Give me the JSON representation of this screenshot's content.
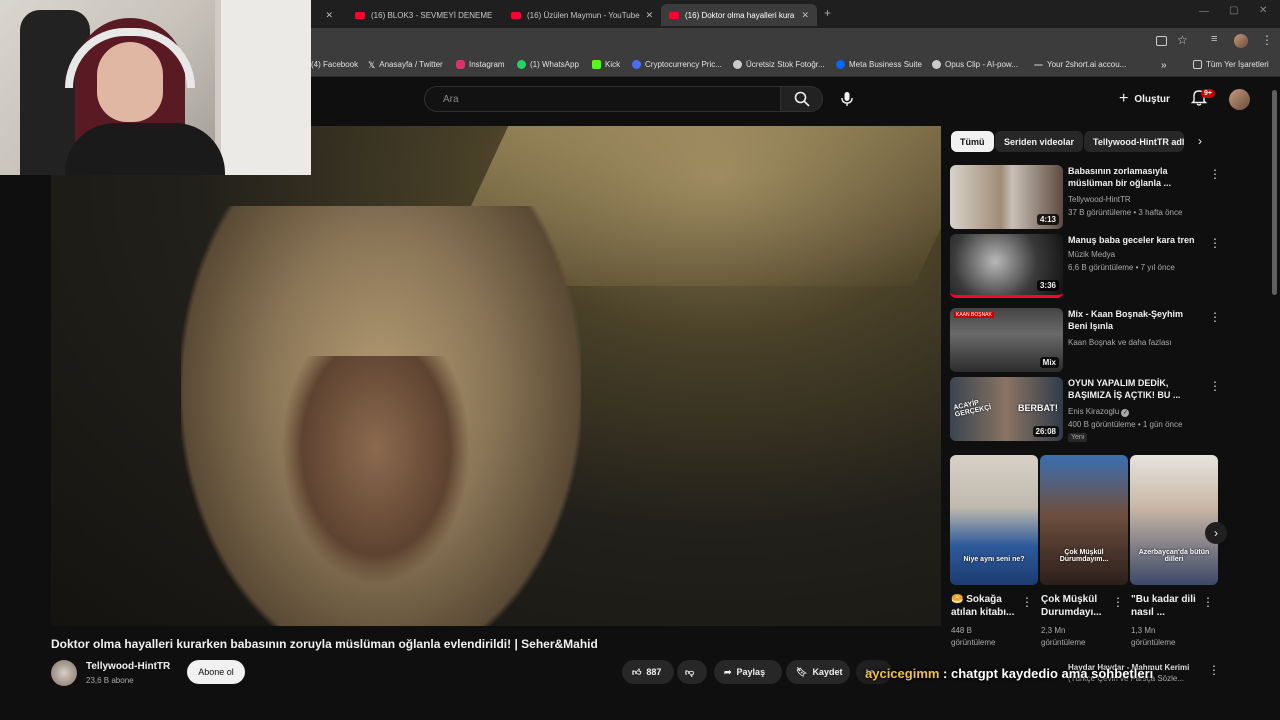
{
  "tabs": [
    {
      "label": "(16) BLOK3 - SEVMEYİ DENEME"
    },
    {
      "label": "(16) Üzülen Maymun - YouTube"
    },
    {
      "label": "(16) Doktor olma hayalleri kura"
    }
  ],
  "bookmarks": [
    {
      "label": "(4) Facebook",
      "color": "#1877f2"
    },
    {
      "label": "Anasayfa / Twitter",
      "color": "#ffffff"
    },
    {
      "label": "Instagram",
      "color": "#e1306c"
    },
    {
      "label": "(1) WhatsApp",
      "color": "#25d366"
    },
    {
      "label": "Kick",
      "color": "#53fc18"
    },
    {
      "label": "Cryptocurrency Pric...",
      "color": "#4a6cf7"
    },
    {
      "label": "Ücretsiz Stok Fotoğr...",
      "color": "#cccccc"
    },
    {
      "label": "Meta Business Suite",
      "color": "#0866ff"
    },
    {
      "label": "Opus Clip - AI-pow...",
      "color": "#cccccc"
    },
    {
      "label": "Your 2short.ai accou...",
      "color": "#888888"
    }
  ],
  "bookmarks_all": "Tüm Yer İşaretleri",
  "header": {
    "search_placeholder": "Ara",
    "create_label": "Oluştur",
    "notif_badge": "9+"
  },
  "video": {
    "title": "Doktor olma hayalleri kurarken babasının zoruyla müslüman oğlanla evlendirildi! | Seher&Mahid",
    "channel": "Tellywood-HintTR",
    "subs": "23,6 B abone",
    "subscribe_label": "Abone ol",
    "likes": "887",
    "share_label": "Paylaş",
    "save_label": "Kaydet"
  },
  "overlay": {
    "gold": "aycicegimm",
    "rest": " : chatgpt kaydedio ama sohbetleri"
  },
  "chips": [
    "Tümü",
    "Seriden videolar",
    "Tellywood-HintTR adl"
  ],
  "related": [
    {
      "title": "Babasının zorlamasıyla müslüman bir oğlanla ...",
      "channel": "Tellywood-HintTR",
      "meta": "37 B görüntüleme • 3 hafta önce",
      "duration": "4:13"
    },
    {
      "title": "Manuş baba geceler kara tren",
      "channel": "Müzik Medya",
      "meta": "6,6 B görüntüleme • 7 yıl önce",
      "duration": "3:36"
    },
    {
      "title": "Mix - Kaan Boşnak-Şeyhim Beni Işınla",
      "channel": "Kaan Boşnak ve daha fazlası",
      "meta": "",
      "duration": "Mix"
    },
    {
      "title": "OYUN YAPALIM DEDİK, BAŞIMIZA İŞ AÇTIK! BU ...",
      "channel": "Enis Kirazoglu",
      "meta": "400 B görüntüleme • 1 gün önce",
      "duration": "26:08",
      "tag": "Yeni"
    }
  ],
  "shorts": [
    {
      "title": "🥯 Sokağa atılan kitabı...",
      "views": "448 B",
      "views_label": "görüntüleme",
      "caption": "Niye aynı seni ne?"
    },
    {
      "title": "Çok Müşkül Durumdayı...",
      "views": "2,3 Mn",
      "views_label": "görüntüleme",
      "caption": "Çok Müşkül Durumdayım..."
    },
    {
      "title": "\"Bu kadar dili nasıl ...",
      "views": "1,3 Mn",
      "views_label": "görüntüleme",
      "caption": "Azerbaycan'da bütün dilleri"
    }
  ],
  "bottom_related": {
    "title": "Haydar Haydar - Mahmut Kerimi",
    "sub": "(Türkçe Çeviri ve Farsça Sözle..."
  },
  "thumbnail_text": {
    "acayip": "ACAYİP GERÇEKÇİ",
    "berbat": "BERBAT!",
    "kaan": "KAAN BOŞNAK"
  }
}
